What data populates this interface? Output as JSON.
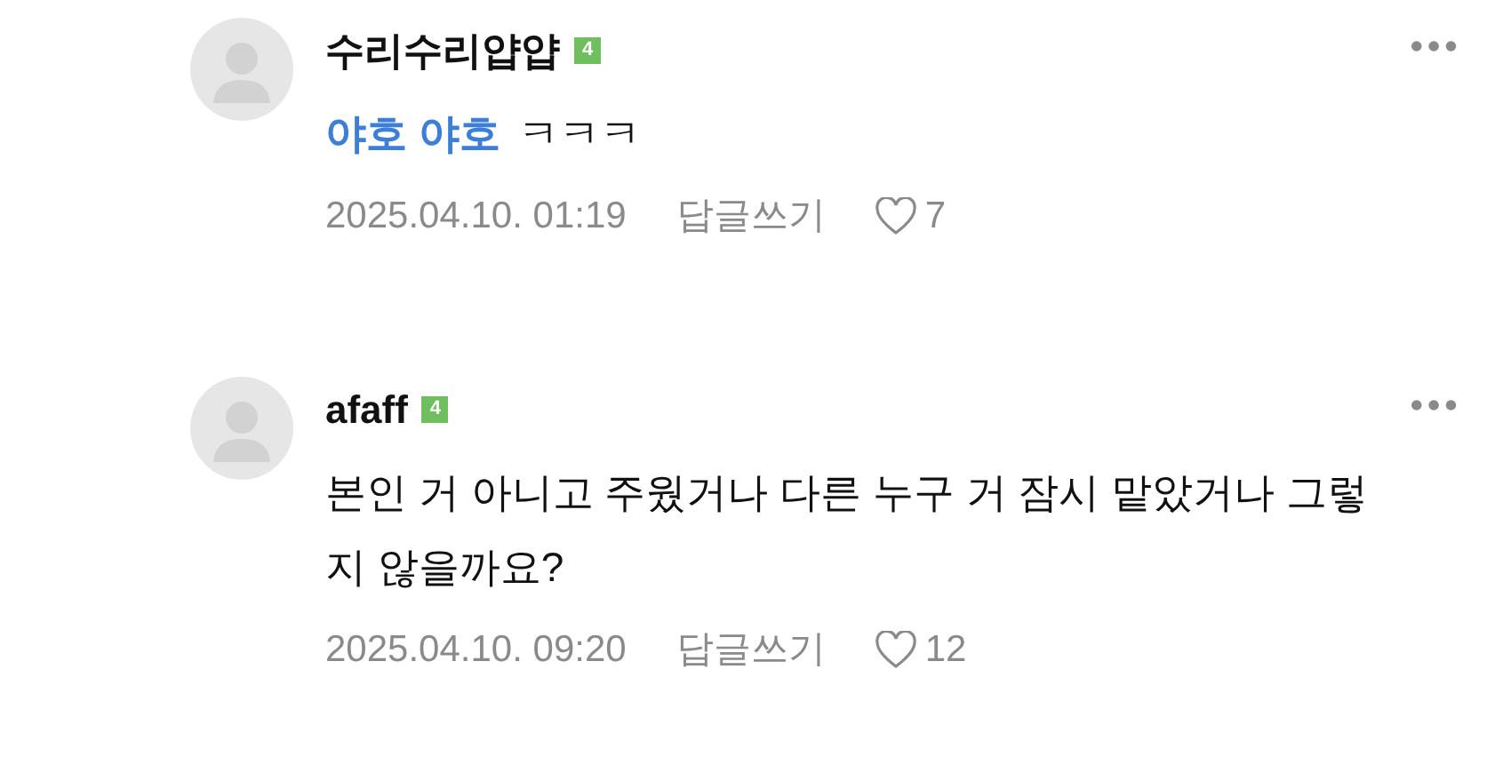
{
  "comments": [
    {
      "author": "수리수리얍얍",
      "badge": "4",
      "mention": "야호 야호",
      "text": "ㅋㅋㅋ",
      "date": "2025.04.10. 01:19",
      "reply": "답글쓰기",
      "likes": "7"
    },
    {
      "author": "afaff",
      "badge": "4",
      "text": "본인 거 아니고 주웠거나 다른 누구 거 잠시 맡았거나 그렇지 않을까요?",
      "date": "2025.04.10. 09:20",
      "reply": "답글쓰기",
      "likes": "12"
    }
  ]
}
